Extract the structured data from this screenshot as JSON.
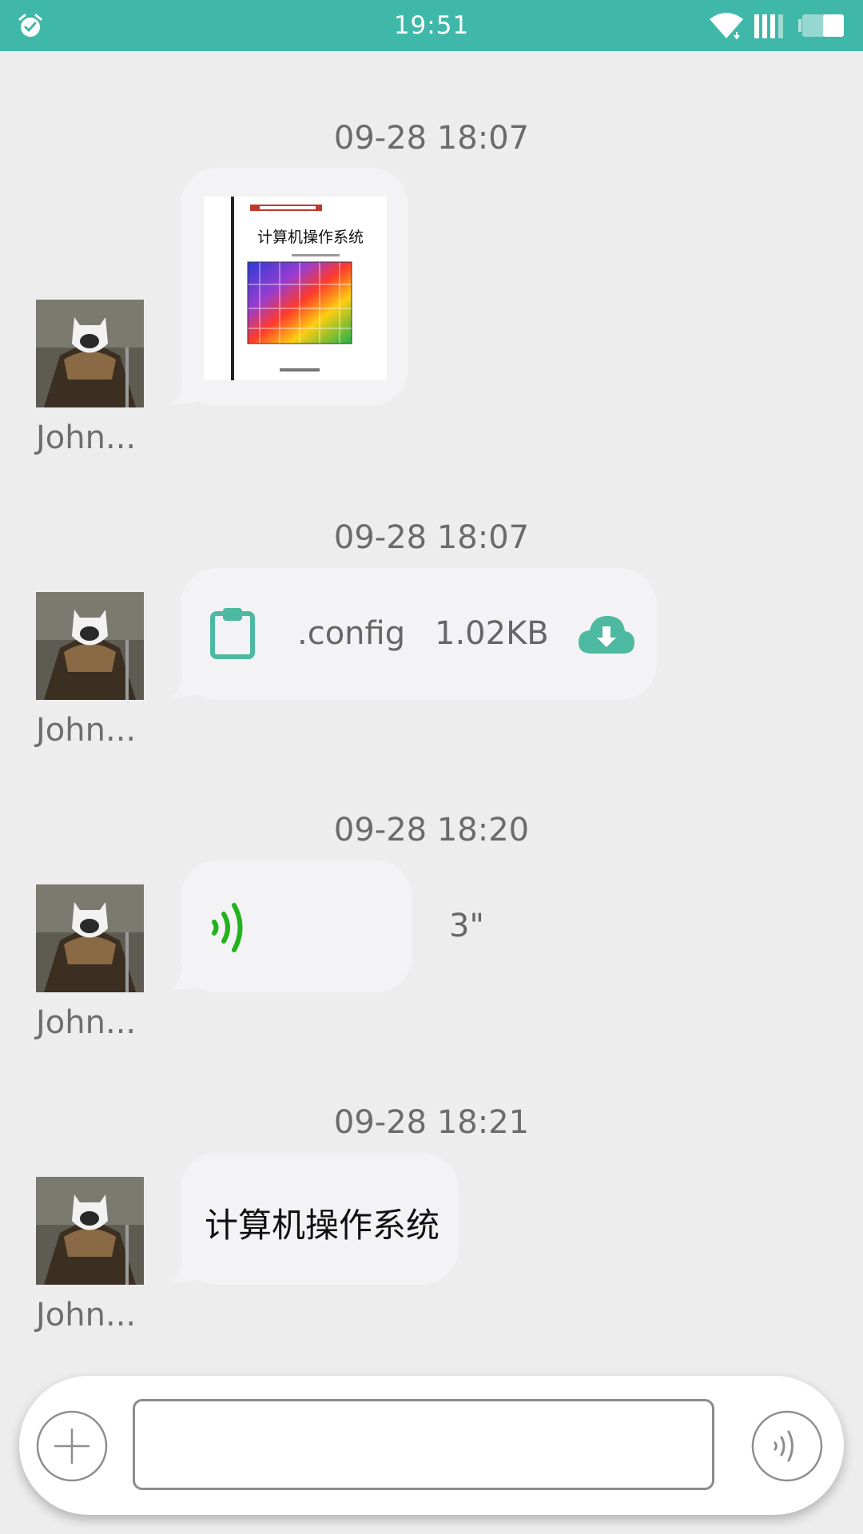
{
  "status_bar": {
    "time": "19:51",
    "icons": [
      "alarm-icon",
      "wifi-icon",
      "signal-icon",
      "battery-icon"
    ],
    "color": "#3fb8a9"
  },
  "messages": [
    {
      "type": "image",
      "timestamp": "09-28 18:07",
      "sender": "John...",
      "image": {
        "title": "计算机操作系统"
      }
    },
    {
      "type": "file",
      "timestamp": "09-28 18:07",
      "sender": "John...",
      "file_name": ".config",
      "file_size": "1.02KB",
      "icons": [
        "clipboard-icon",
        "cloud-download-icon"
      ]
    },
    {
      "type": "voice",
      "timestamp": "09-28 18:20",
      "sender": "John...",
      "duration": "3\"",
      "icon": "voice-wave-icon"
    },
    {
      "type": "text",
      "timestamp": "09-28 18:21",
      "sender": "John...",
      "text": "计算机操作系统"
    }
  ],
  "input_bar": {
    "value": "",
    "placeholder": "",
    "icons": [
      "plus-icon",
      "voice-input-icon"
    ]
  },
  "colors": {
    "accent": "#3fb8a9",
    "file_icon": "#4cb9a0",
    "voice_wave": "#22b31c",
    "bubble": "#f3f3f5",
    "background": "#ededed"
  }
}
